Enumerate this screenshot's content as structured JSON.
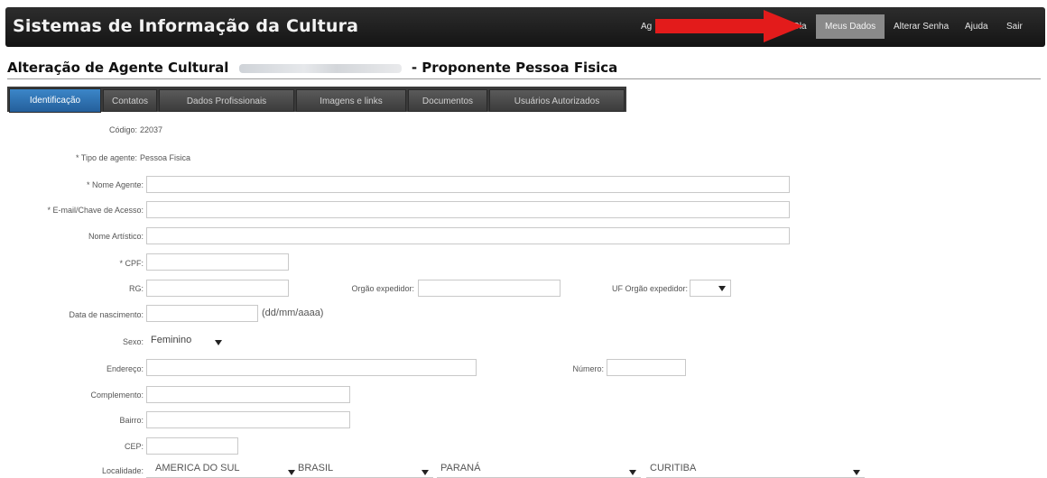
{
  "header": {
    "app_title": "Sistemas de Informação da Cultura",
    "links": {
      "ag": "Ag",
      "ola": "Ola",
      "meus_dados": "Meus Dados",
      "alterar_senha": "Alterar Senha",
      "ajuda": "Ajuda",
      "sair": "Sair"
    },
    "arrow_color": "#e31b1b"
  },
  "page": {
    "title_prefix": "Alteração de Agente Cultural",
    "title_suffix": "- Proponente Pessoa Fisica"
  },
  "tabs": [
    {
      "label": "Identificação"
    },
    {
      "label": "Contatos"
    },
    {
      "label": "Dados Profissionais"
    },
    {
      "label": "Imagens e links"
    },
    {
      "label": "Documentos"
    },
    {
      "label": "Usuários Autorizados"
    }
  ],
  "form": {
    "codigo_label": "Código:",
    "codigo_value": "22037",
    "tipo_label": "* Tipo de agente:",
    "tipo_value": "Pessoa Fisica",
    "nome_label": "* Nome Agente:",
    "email_label": "* E-mail/Chave de Acesso:",
    "artistico_label": "Nome Artístico:",
    "cpf_label": "* CPF:",
    "rg_label": "RG:",
    "orgao_label": "Orgão expedidor:",
    "uf_label": "UF Orgão expedidor:",
    "nascimento_label": "Data de nascimento:",
    "nascimento_hint": "(dd/mm/aaaa)",
    "sexo_label": "Sexo:",
    "sexo_value": "Feminino",
    "endereco_label": "Endereço:",
    "numero_label": "Número:",
    "complemento_label": "Complemento:",
    "bairro_label": "Bairro:",
    "cep_label": "CEP:",
    "localidade_label": "Localidade:",
    "localidade": [
      "AMERICA DO SUL",
      "BRASIL",
      "PARANÁ",
      "CURITIBA"
    ]
  }
}
